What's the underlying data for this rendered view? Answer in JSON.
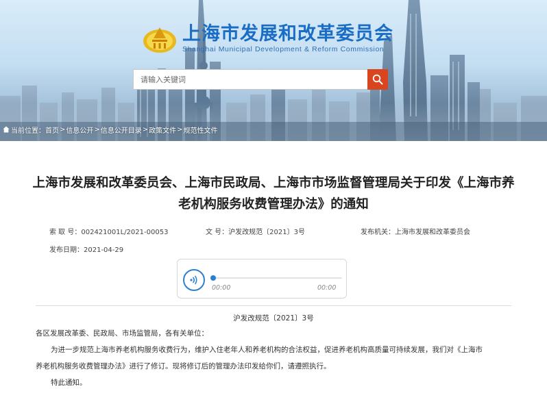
{
  "header": {
    "org_name_cn": "上海市发展和改革委员会",
    "org_name_en": "Shanghai Municipal Development & Reform Commission"
  },
  "search": {
    "placeholder": "请输入关键词",
    "button_icon": "search-icon"
  },
  "breadcrumb": {
    "prefix": "当前位置：",
    "items": [
      "首页",
      "信息公开",
      "信息公开目录",
      "政策文件",
      "规范性文件"
    ],
    "separator": ">"
  },
  "article": {
    "title_line1": "上海市发展和改革委员会、上海市民政局、上海市市场监督管理局关于印发《上海市养",
    "title_line2": "老机构服务收费管理办法》的通知"
  },
  "meta": {
    "index_label": "索  取  号：",
    "index_value": "002421001L/2021-00053",
    "docno_label": "文  号：",
    "docno_value": "沪发改规范〔2021〕3号",
    "issuer_label": "发布机关：",
    "issuer_value": "上海市发展和改革委员会",
    "date_label": "发布日期：",
    "date_value": "2021-04-29"
  },
  "player": {
    "current_time": "00:00",
    "duration": "00:00",
    "progress": 0,
    "accent_color": "#2b7fd0"
  },
  "body": {
    "doc_number": "沪发改规范〔2021〕3号",
    "salutation": "各区发展改革委、民政局、市场监管局，各有关单位：",
    "para1_line1": "为进一步规范上海市养老机构服务收费行为，维护入住老年人和养老机构的合法权益，促进养老机构高质量可持续发展，我们对《上海市",
    "para1_line2": "养老机构服务收费管理办法》进行了修订。现将修订后的管理办法印发给你们，请遵照执行。",
    "closing": "特此通知。"
  },
  "colors": {
    "logo_blue": "#1a6dc4",
    "search_button": "#d9451f"
  }
}
